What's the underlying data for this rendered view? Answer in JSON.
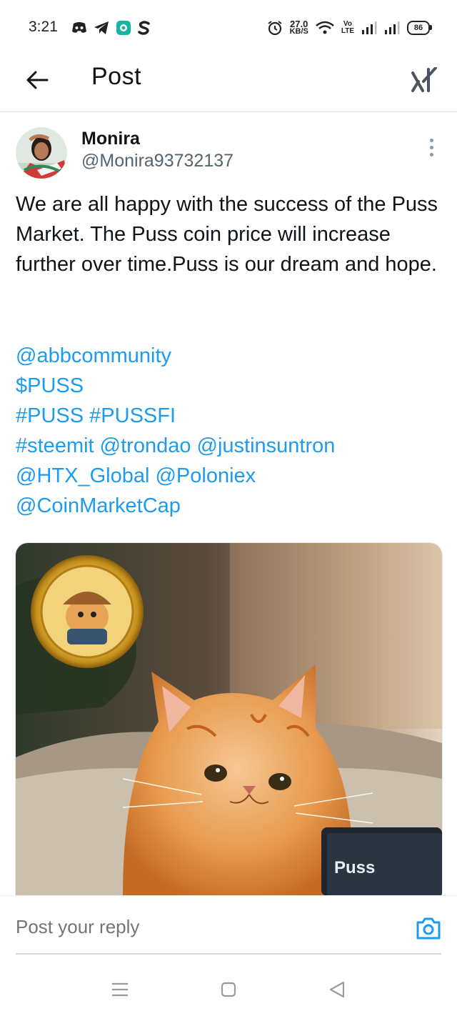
{
  "status_bar": {
    "time": "3:21",
    "net_speed_value": "27.0",
    "net_speed_unit": "KB/S",
    "volte_top": "Vo",
    "volte_bottom": "LTE",
    "battery": "86"
  },
  "header": {
    "title": "Post"
  },
  "post": {
    "display_name": "Monira",
    "handle": "@Monira93732137",
    "text": "We are all happy with the success of the Puss Market. The Puss coin price will increase further over time.Puss is our dream and hope.",
    "links": [
      [
        "@abbcommunity"
      ],
      [
        "$PUSS"
      ],
      [
        "#PUSS",
        "#PUSSFI"
      ],
      [
        "#steemit",
        "@trondao",
        "@justinsuntron"
      ],
      [
        "@HTX_Global",
        "@Poloniex"
      ],
      [
        "@CoinMarketCap"
      ]
    ],
    "image": {
      "screen_text": "Puss"
    }
  },
  "reply": {
    "placeholder": "Post your reply"
  },
  "colors": {
    "link": "#1d9bf0",
    "text": "#0f1419",
    "secondary": "#536471",
    "camera_icon": "#1d9bf0"
  }
}
